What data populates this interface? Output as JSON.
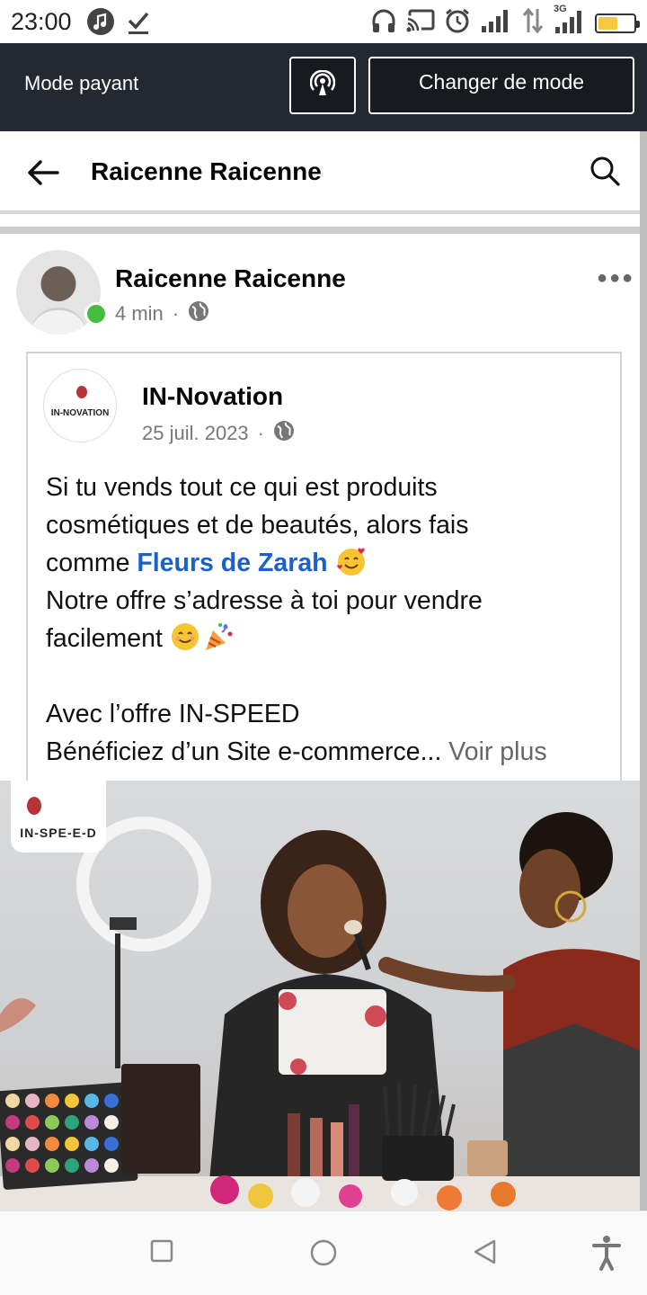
{
  "status_bar": {
    "time": "23:00",
    "network": "3G",
    "battery_level": 0.55,
    "icons": [
      "music-icon",
      "check-download-icon",
      "headphones-icon",
      "cast-icon",
      "alarm-icon",
      "signal-icon",
      "data-transfer-icon",
      "signal-3g-icon",
      "battery-icon"
    ]
  },
  "mode_bar": {
    "label": "Mode payant",
    "switch_button": "Changer de mode",
    "icon": "broadcast-icon"
  },
  "header": {
    "title": "Raicenne Raicenne",
    "back_icon": "back-arrow-icon",
    "search_icon": "search-icon"
  },
  "post": {
    "author": "Raicenne Raicenne",
    "time": "4 min",
    "separator": "·",
    "privacy_icon": "globe-icon",
    "more_icon": "more-dots-icon",
    "online_color": "#45bd3f",
    "shared": {
      "page_name": "IN-Novation",
      "logo_text": "IN-NOVATION",
      "date": "25 juil. 2023",
      "separator": "·",
      "text": {
        "line1": "Si tu vends tout ce qui est produits",
        "line2": "cosmétiques et de beautés, alors fais",
        "line3_prefix": "comme ",
        "mention": "Fleurs de Zarah",
        "line4": "Notre offre s’adresse à toi pour vendre",
        "line5": "facilement",
        "line6": "Avec l’offre IN-SPEED",
        "line7": "Bénéficiez d’un Site e-commerce...",
        "see_more": "Voir plus"
      },
      "emojis": [
        "smiling-face-with-hearts-icon",
        "smiling-face-icon",
        "party-popper-icon"
      ]
    },
    "image": {
      "badge_text": "IN-SPE-E-D"
    }
  },
  "colors": {
    "mode_bar_bg": "#242830",
    "mention": "#1b61c9",
    "text": "#050505",
    "muted": "#777777"
  },
  "nav_bar": {
    "icons": [
      "recent-apps-icon",
      "home-icon",
      "back-icon",
      "accessibility-icon"
    ]
  }
}
